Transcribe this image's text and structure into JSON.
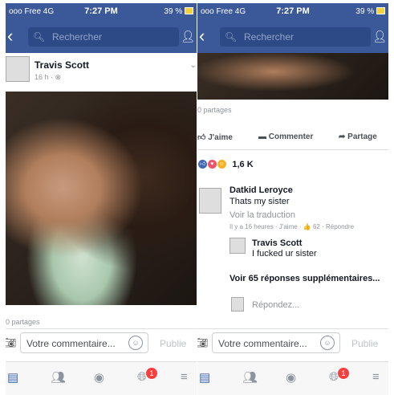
{
  "status": {
    "carrier": "ooo Free 4G",
    "time": "7:27 PM",
    "battery": "39 %"
  },
  "search": {
    "placeholder": "Rechercher"
  },
  "post": {
    "author": "Travis Scott",
    "meta": "16 h · ⊗",
    "shares": "0 partages"
  },
  "composer": {
    "placeholder": "Votre commentaire...",
    "publish": "Publie"
  },
  "actions": {
    "like": "J'aime",
    "comment": "Commenter",
    "share": "Partage"
  },
  "reactions": {
    "count": "1,6 K"
  },
  "comment": {
    "author": "Datkid Leroyce",
    "text": "Thats my sister",
    "translate": "Voir la traduction",
    "meta": "Il y a 16 heures · J'aime · 👍 62 · Répondre"
  },
  "reply": {
    "author": "Travis Scott",
    "text": "I fucked ur sister"
  },
  "more_replies": "Voir 65 réponses supplémentaires...",
  "reply_placeholder": "Répondez...",
  "tabs": {
    "notifications_badge": "1"
  },
  "colors": {
    "brand": "#3b5998",
    "badge": "#fa3e3e",
    "battery": "#f2d23c"
  }
}
